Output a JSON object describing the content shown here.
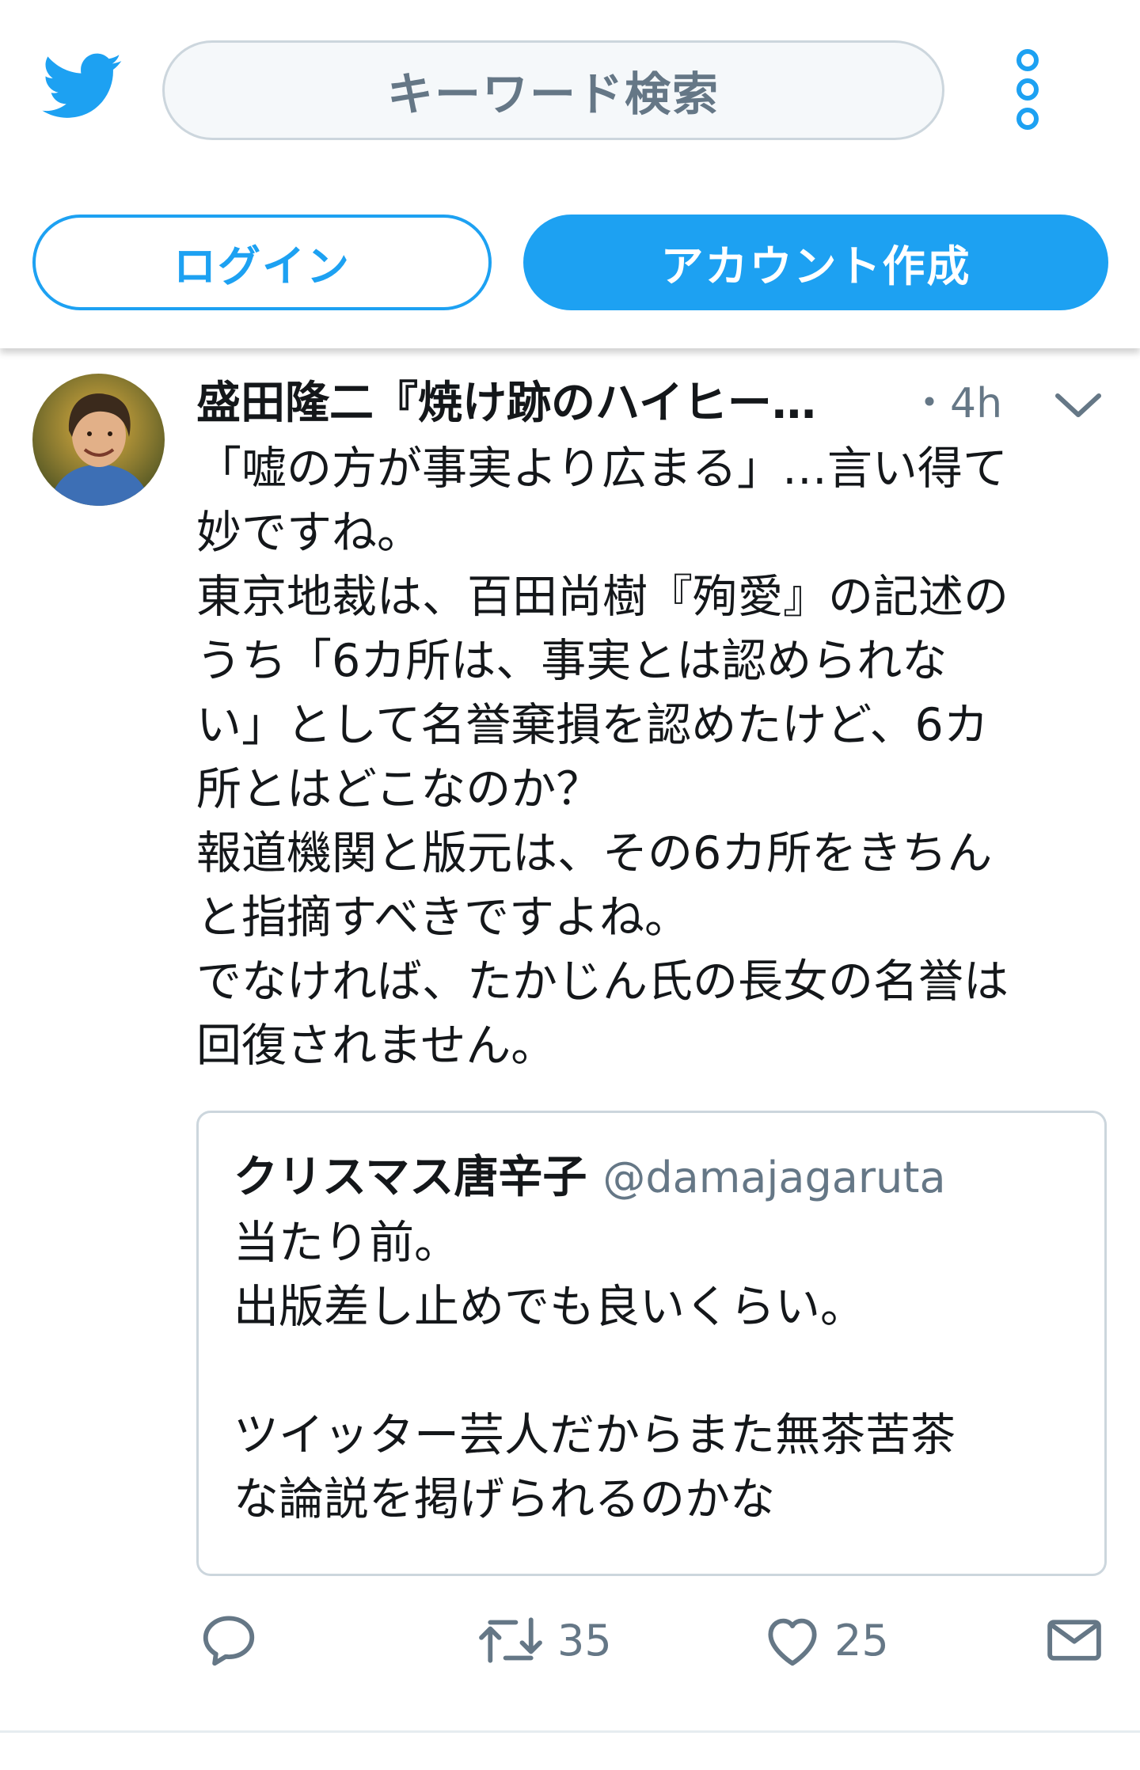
{
  "header": {
    "search_placeholder": "キーワード検索",
    "login_label": "ログイン",
    "signup_label": "アカウント作成",
    "icons": [
      "twitter-bird-icon",
      "more-vertical-icon"
    ]
  },
  "tweet": {
    "author": "盛田隆二『焼け跡のハイヒー…",
    "time": "・4h",
    "text": "「嘘の方が事実より広まる」…言い得て\n妙ですね。\n東京地裁は、百田尚樹『殉愛』の記述の\nうち「6カ所は、事実とは認められな\nい」として名誉棄損を認めたけど、6カ\n所とはどこなのか？\n報道機関と版元は、その6カ所をきちん\nと指摘すべきですよね。\nでなければ、たかじん氏の長女の名誉は\n回復されません。",
    "quote": {
      "name": "クリスマス唐辛子",
      "handle": "@damajagaruta",
      "text": "当たり前。\n出版差し止めでも良いくらい。\n\nツイッター芸人だからまた無茶苦茶\nな論説を掲げられるのかな"
    },
    "actions": {
      "retweets": "35",
      "likes": "25",
      "icons": [
        "reply-icon",
        "retweet-icon",
        "heart-icon",
        "message-icon"
      ]
    }
  },
  "colors": {
    "brand": "#1da1f2",
    "text": "#14171a",
    "secondary": "#657786",
    "border": "#ccd6dd"
  }
}
